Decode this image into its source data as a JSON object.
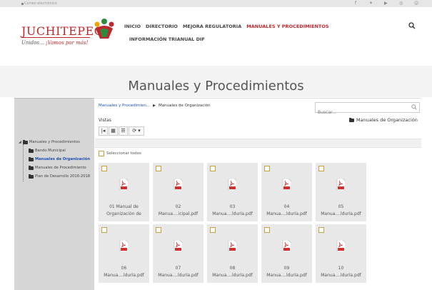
{
  "topbar": {
    "email_text": "Correo electrónico"
  },
  "logo": {
    "word": "JUCHITEPEC",
    "tag_plain": "Unidos...",
    "tag_red": "¡Vamos por más!"
  },
  "nav": {
    "items": [
      {
        "label": "INICIO"
      },
      {
        "label": "DIRECTORIO"
      },
      {
        "label": "MEJORA REGULATORIA"
      },
      {
        "label": "MANUALES Y PROCEDIMIENTOS"
      }
    ],
    "second_row": "INFORMACIÓN TRIANUAL DIF"
  },
  "page": {
    "title": "Manuales y Procedimientos"
  },
  "tree": {
    "root": "Manuales y Procedimientos",
    "children": [
      {
        "label": "Bando Municipal"
      },
      {
        "label": "Manuales de Organización"
      },
      {
        "label": "Manuales de Procedimiento"
      },
      {
        "label": "Plan de Desarrollo 2016-2018"
      }
    ]
  },
  "breadcrumb": {
    "first": "Manuales y Procedimien...",
    "separator": "▶",
    "current": "Manuales de Organización"
  },
  "search": {
    "placeholder": "Buscar..."
  },
  "vistas": {
    "label": "Vistas"
  },
  "current_folder": {
    "label": "Manuales de Organización"
  },
  "toolbar": {
    "collapse": "|◂",
    "grid": "▦",
    "list": "☰",
    "refresh": "⟳ ▾"
  },
  "select_all": {
    "label": "Seleccionar todos"
  },
  "files": [
    {
      "name1": "01 Manual de",
      "name2": "Organización de"
    },
    {
      "name1": "02",
      "name2": "Manua....icipal.pdf"
    },
    {
      "name1": "03",
      "name2": "Manua....lduría.pdf"
    },
    {
      "name1": "04",
      "name2": "Manua....lduría.pdf"
    },
    {
      "name1": "05",
      "name2": "Manua....lduría.pdf"
    },
    {
      "name1": "06",
      "name2": "Manua....lduría.pdf"
    },
    {
      "name1": "07",
      "name2": "Manua....lduría.pdf"
    },
    {
      "name1": "08",
      "name2": "Manua....lduría.pdf"
    },
    {
      "name1": "09",
      "name2": "Manua....lduría.pdf"
    },
    {
      "name1": "10",
      "name2": "Manua....lduría.pdf"
    }
  ],
  "colors": {
    "brand_red": "#c0272d",
    "link_blue": "#1e4fb5",
    "tile_bg": "#e8e8e8",
    "sidebar_bg": "#d6d6d6"
  }
}
